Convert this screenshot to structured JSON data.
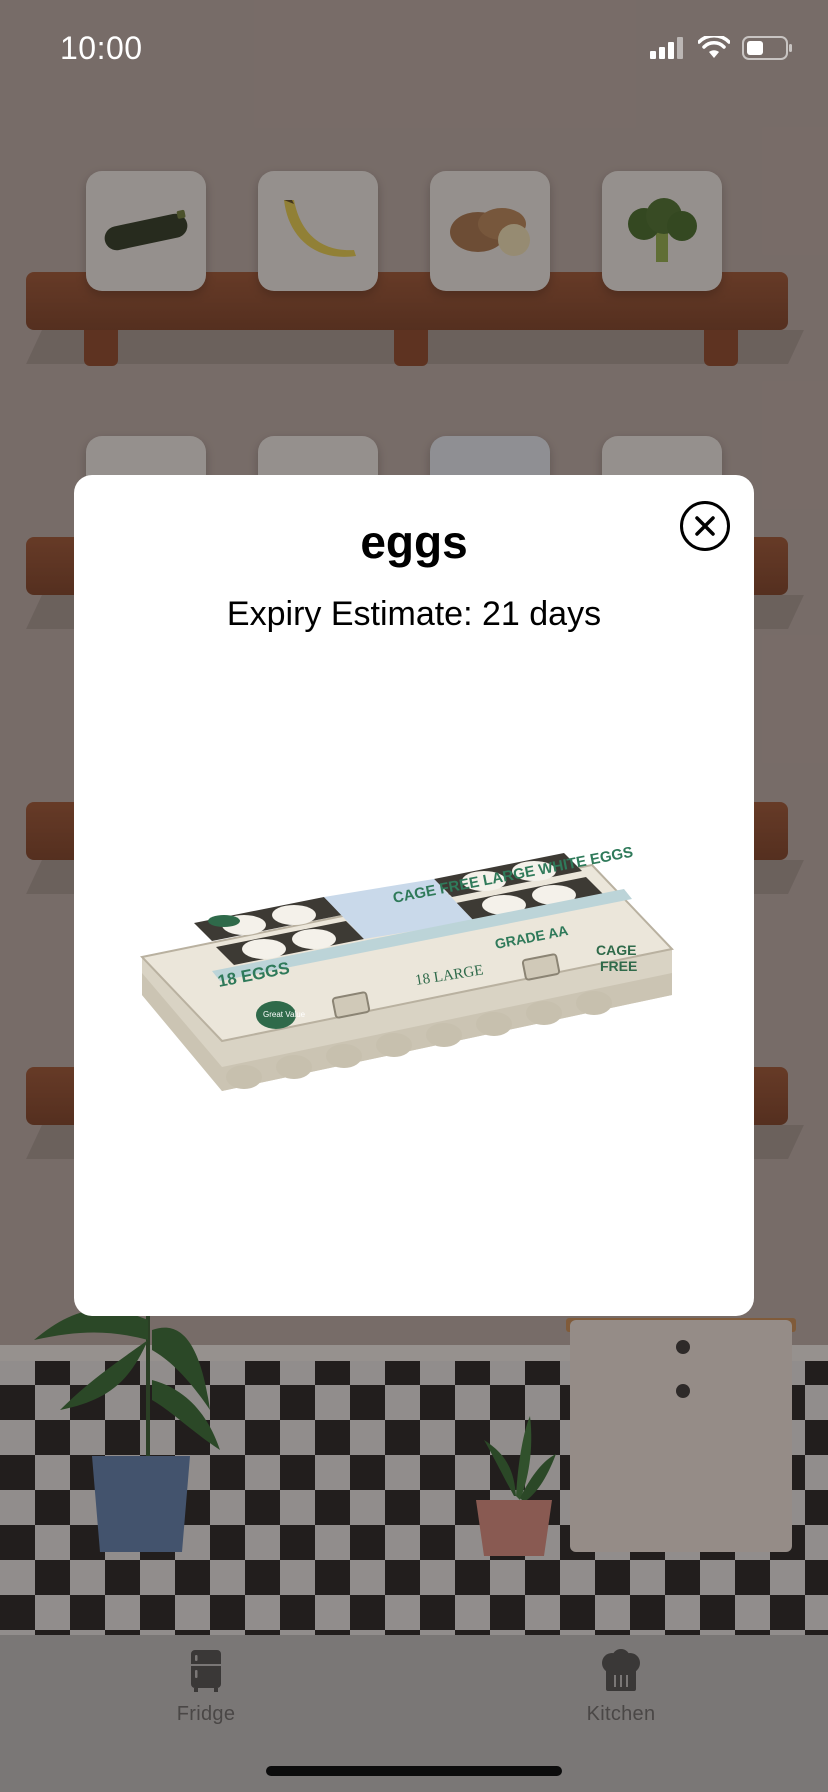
{
  "status_bar": {
    "time": "10:00"
  },
  "modal": {
    "title": "eggs",
    "subtitle": "Expiry Estimate: 21 days",
    "image_icon": "egg-carton-image",
    "carton_text": {
      "top_label": "CAGE FREE LARGE WHITE EGGS",
      "count_label": "18 EGGS",
      "size_label": "18 LARGE",
      "grade_label": "GRADE AA",
      "cage_free_line1": "CAGE",
      "cage_free_line2": "FREE",
      "brand": "Great Value"
    }
  },
  "shelf_items": [
    {
      "name": "zucchini"
    },
    {
      "name": "banana"
    },
    {
      "name": "potatoes"
    },
    {
      "name": "broccoli"
    }
  ],
  "tab_bar": {
    "tabs": [
      {
        "label": "Fridge",
        "icon": "fridge-icon"
      },
      {
        "label": "Kitchen",
        "icon": "chef-hat-icon"
      }
    ]
  },
  "colors": {
    "shelf": "#8a4425",
    "modal_background": "#ffffff",
    "tab_bar_background": "#7a7776"
  }
}
